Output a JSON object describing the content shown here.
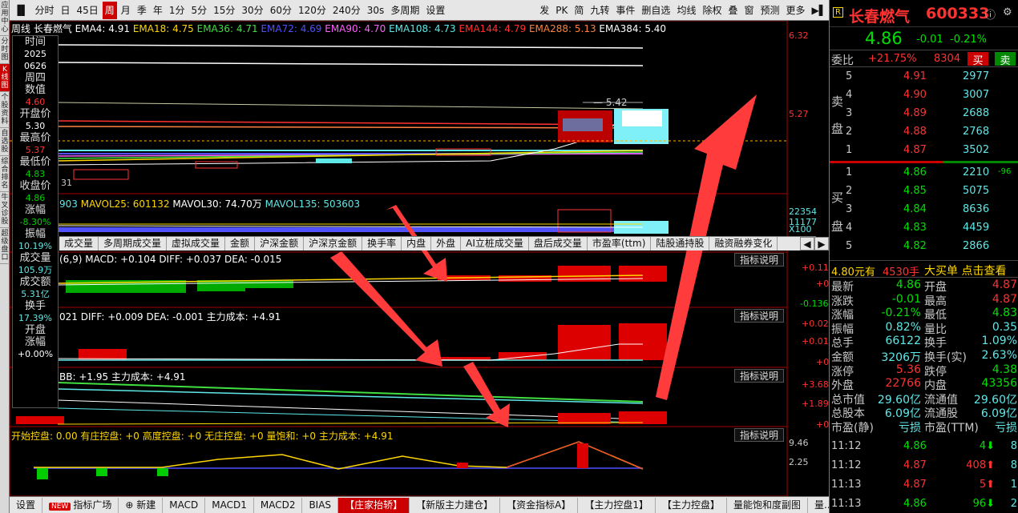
{
  "sidebar": {
    "items": [
      "应用中心",
      "分时图",
      "K线图",
      "个股资料",
      "自选股",
      "综合排名",
      "牛叉诊股",
      "超级盘口"
    ]
  },
  "toolbar": {
    "items": [
      "分时",
      "日",
      "45日",
      "周",
      "月",
      "季",
      "年",
      "1分",
      "5分",
      "15分",
      "30分",
      "60分",
      "120分",
      "240分",
      "30s",
      "多周期",
      "设置"
    ],
    "active": "周",
    "right_items": [
      "发",
      "PK",
      "简",
      "九转",
      "事件",
      "删自选",
      "均线",
      "除权",
      "叠",
      "窗",
      "预测",
      "更多"
    ]
  },
  "ma_line": {
    "prefix": "周线 长春燃气",
    "items": [
      {
        "label": "EMA4: 4.91",
        "color": "#ffffff"
      },
      {
        "label": "EMA18: 4.75",
        "color": "#ffd700"
      },
      {
        "label": "EMA36: 4.71",
        "color": "#40e040"
      },
      {
        "label": "EMA72: 4.69",
        "color": "#5050ff"
      },
      {
        "label": "EMA90: 4.70",
        "color": "#ff60ff"
      },
      {
        "label": "EMA108: 4.73",
        "color": "#5ee8e8"
      },
      {
        "label": "EMA144: 4.79",
        "color": "#ff3232"
      },
      {
        "label": "EMA288: 5.13",
        "color": "#ff8040"
      },
      {
        "label": "EMA384: 5.40",
        "color": "#ffffff"
      }
    ]
  },
  "price_axis": {
    "top": "6.32",
    "mid": "5.27",
    "marker": "5.42",
    "low": "31"
  },
  "info": {
    "time_label": "时间",
    "year": "2025",
    "date": "0626",
    "weekday": "周四",
    "value_label": "数值",
    "value": "4.60",
    "open_label": "开盘价",
    "open": "5.30",
    "high_label": "最高价",
    "high": "5.37",
    "low_label": "最低价",
    "low": "4.83",
    "close_label": "收盘价",
    "close": "4.86",
    "chg_label": "涨幅",
    "chg": "-8.30%",
    "amp_label": "振幅",
    "amp": "10.19%",
    "vol_label": "成交量",
    "vol": "105.9万",
    "amt_label": "成交额",
    "amt": "5.31亿",
    "turn_label": "换手",
    "turn": "17.39%",
    "open_chg_label1": "开盘",
    "open_chg_label2": "涨幅",
    "open_chg": "+0.00%"
  },
  "vol_line": {
    "items": [
      {
        "label": "903",
        "color": "#5ee8e8"
      },
      {
        "label": "MAVOL25: 601132",
        "color": "#ffd700"
      },
      {
        "label": "MAVOL30: 74.70万",
        "color": "#fff"
      },
      {
        "label": "MAVOL135: 503603",
        "color": "#5ee8e8"
      }
    ],
    "axis": [
      "22354",
      "11177",
      "X100"
    ]
  },
  "tabs": [
    "成交量",
    "多周期成交量",
    "虚拟成交量",
    "金额",
    "沪深金额",
    "沪深京金额",
    "换手率",
    "内盘",
    "外盘",
    "AI立桩成交量",
    "盘后成交量",
    "市盈率(ttm)",
    "陆股通持股",
    "融资融券变化"
  ],
  "macd": {
    "text": "(6,9) MACD: +0.104 DIFF: +0.037 DEA: -0.015",
    "btn": "指标说明",
    "axis": [
      "+0.118",
      "+0",
      "-0.136"
    ]
  },
  "ind2": {
    "text": "021 DIFF: +0.009 DEA: -0.001 主力成本: +4.91",
    "btn": "指标说明",
    "axis": [
      "+0.022",
      "+0.012",
      "+0"
    ]
  },
  "ind3": {
    "text": "BB: +1.95 主力成本: +4.91",
    "btn": "指标说明",
    "axis": [
      "+3.68",
      "+1.89",
      "+0"
    ]
  },
  "ind4": {
    "text": "开始控盘: 0.00 有庄控盘: +0 高度控盘: +0 无庄控盘: +0 量饱和: +0 主力成本: +4.91",
    "btn": "指标说明",
    "axis": [
      "9.46",
      "2.25"
    ]
  },
  "bottom_tabs": [
    "设置",
    "指标广场",
    "新建",
    "MACD",
    "MACD1",
    "MACD2",
    "BIAS",
    "【庄家抬轿】",
    "【新版主力建仓】",
    "【资金指标A】",
    "【主力控盘1】",
    "【主力控盘】",
    "量能饱和度副图",
    "量..."
  ],
  "bottom_active": "【庄家抬轿】",
  "stock": {
    "name": "长春燃气",
    "code": "600333",
    "price": "4.86",
    "change": "-0.01",
    "pct": "-0.21%"
  },
  "weibi": {
    "label": "委比",
    "pct": "+21.75%",
    "diff": "8304",
    "buy": "买",
    "sell": "卖"
  },
  "sell_label": [
    "卖",
    "盘"
  ],
  "buy_label": [
    "买",
    "盘"
  ],
  "asks": [
    {
      "n": "5",
      "p": "4.91",
      "v": "2977"
    },
    {
      "n": "4",
      "p": "4.90",
      "v": "3007"
    },
    {
      "n": "3",
      "p": "4.89",
      "v": "2688"
    },
    {
      "n": "2",
      "p": "4.88",
      "v": "2768"
    },
    {
      "n": "1",
      "p": "4.87",
      "v": "3502"
    }
  ],
  "bids": [
    {
      "n": "1",
      "p": "4.86",
      "v": "2210",
      "d": "-96"
    },
    {
      "n": "2",
      "p": "4.85",
      "v": "5075",
      "d": ""
    },
    {
      "n": "3",
      "p": "4.84",
      "v": "8636",
      "d": ""
    },
    {
      "n": "4",
      "p": "4.83",
      "v": "4459",
      "d": ""
    },
    {
      "n": "5",
      "p": "4.82",
      "v": "2866",
      "d": ""
    }
  ],
  "bigorder": {
    "price": "4.80元有",
    "vol": "4530手",
    "text": "大买单 点击查看"
  },
  "quote": [
    [
      "最新",
      "4.86",
      "开盘",
      "4.87"
    ],
    [
      "涨跌",
      "-0.01",
      "最高",
      "4.87"
    ],
    [
      "涨幅",
      "-0.21%",
      "最低",
      "4.83"
    ],
    [
      "振幅",
      "0.82%",
      "量比",
      "0.35"
    ],
    [
      "总手",
      "66122",
      "换手",
      "1.09%"
    ],
    [
      "金额",
      "3206万",
      "换手(实)",
      "2.63%"
    ],
    [
      "涨停",
      "5.36",
      "跌停",
      "4.38"
    ],
    [
      "外盘",
      "22766",
      "内盘",
      "43356"
    ],
    [
      "总市值",
      "29.60亿",
      "流通值",
      "29.60亿"
    ],
    [
      "总股本",
      "6.09亿",
      "流通股",
      "6.09亿"
    ],
    [
      "市盈(静)",
      "亏损",
      "市盈(TTM)",
      "亏损"
    ]
  ],
  "ticks": [
    {
      "t": "11:12",
      "p": "4.86",
      "v": "4",
      "d": "8"
    },
    {
      "t": "11:12",
      "p": "4.87",
      "v": "408",
      "d": "8"
    },
    {
      "t": "11:13",
      "p": "4.87",
      "v": "5",
      "d": "1"
    },
    {
      "t": "11:13",
      "p": "4.86",
      "v": "96",
      "d": "2"
    }
  ]
}
